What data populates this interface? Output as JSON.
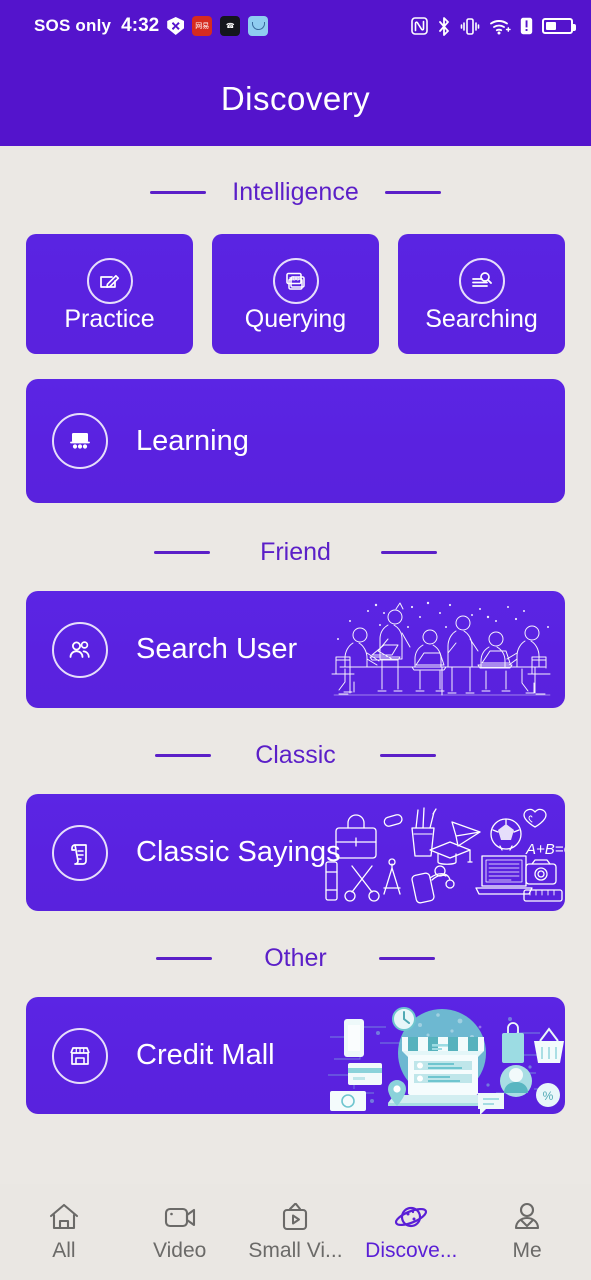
{
  "statusbar": {
    "carrier": "SOS only",
    "time": "4:32",
    "left_icons": [
      "shield-x-icon",
      "app-icon-red",
      "app-icon-dark",
      "app-icon-blue"
    ],
    "right_icons": [
      "nfc-icon",
      "bluetooth-icon",
      "vibrate-icon",
      "wifi-icon",
      "alert-icon",
      "battery-icon"
    ]
  },
  "header": {
    "title": "Discovery"
  },
  "sections": [
    {
      "title": "Intelligence",
      "tiles": [
        {
          "label": "Practice",
          "icon": "pen-edit-icon"
        },
        {
          "label": "Querying",
          "icon": "abc-cards-icon"
        },
        {
          "label": "Searching",
          "icon": "document-search-icon"
        }
      ],
      "cards": [
        {
          "label": "Learning",
          "icon": "classroom-board-icon",
          "art": "none"
        }
      ]
    },
    {
      "title": "Friend",
      "tiles": [],
      "cards": [
        {
          "label": "Search User",
          "icon": "people-group-icon",
          "art": "meeting-table-illustration"
        }
      ]
    },
    {
      "title": "Classic",
      "tiles": [],
      "cards": [
        {
          "label": "Classic Sayings",
          "icon": "scroll-document-icon",
          "art": "school-supplies-doodles"
        }
      ]
    },
    {
      "title": "Other",
      "tiles": [],
      "cards": [
        {
          "label": "Credit Mall",
          "icon": "storefront-icon",
          "art": "ecommerce-illustration"
        }
      ]
    }
  ],
  "bottomnav": {
    "items": [
      {
        "label": "All",
        "icon": "home-icon",
        "active": false
      },
      {
        "label": "Video",
        "icon": "camcorder-icon",
        "active": false
      },
      {
        "label": "Small Vi...",
        "icon": "tv-icon",
        "active": false
      },
      {
        "label": "Discove...",
        "icon": "planet-icon",
        "active": true
      },
      {
        "label": "Me",
        "icon": "person-icon",
        "active": false
      }
    ]
  },
  "colors": {
    "header_purple": "#5414cc",
    "card_purple": "#5a22e0",
    "section_text": "#5b1fc8",
    "page_background": "#ebe8e4",
    "nav_active": "#5a1fd6",
    "nav_inactive": "#6b6a68",
    "illustration_teal": "#6fc5cf"
  }
}
